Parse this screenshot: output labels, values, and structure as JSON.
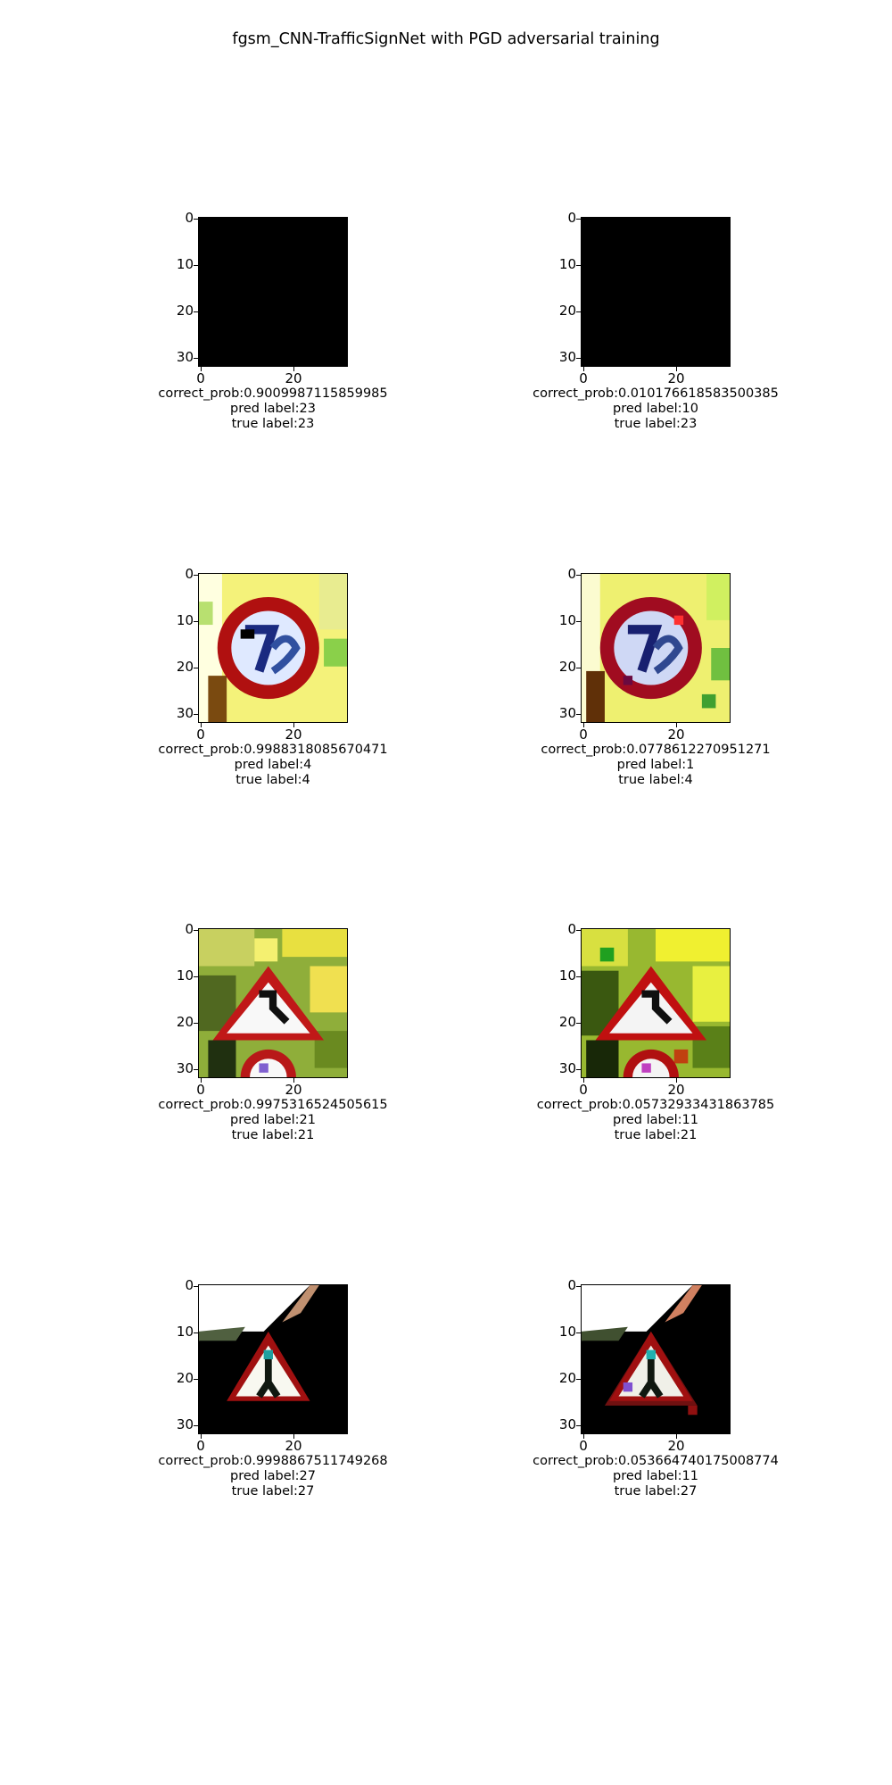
{
  "title": "fgsm_CNN-TrafficSignNet with PGD adversarial training",
  "chart_data": {
    "type": "image-grid",
    "title": "fgsm_CNN-TrafficSignNet with PGD adversarial training",
    "rows": 4,
    "cols": 2,
    "axis_ticks": {
      "x": [
        "0",
        "20"
      ],
      "y": [
        "0",
        "10",
        "20",
        "30"
      ]
    },
    "panels": [
      {
        "kind": "clean",
        "image": "black-square",
        "correct_prob": "correct_prob:0.9009987115859985",
        "pred_label": "pred label:23",
        "true_label": "true label:23"
      },
      {
        "kind": "adversarial",
        "image": "black-square",
        "correct_prob": "correct_prob:0.010176618583500385",
        "pred_label": "pred label:10",
        "true_label": "true label:23"
      },
      {
        "kind": "clean",
        "image": "speed-limit-70-sign",
        "correct_prob": "correct_prob:0.9988318085670471",
        "pred_label": "pred label:4",
        "true_label": "true label:4"
      },
      {
        "kind": "adversarial",
        "image": "speed-limit-70-sign",
        "correct_prob": "correct_prob:0.0778612270951271",
        "pred_label": "pred label:1",
        "true_label": "true label:4"
      },
      {
        "kind": "clean",
        "image": "double-curve-warning-sign",
        "correct_prob": "correct_prob:0.9975316524505615",
        "pred_label": "pred label:21",
        "true_label": "true label:21"
      },
      {
        "kind": "adversarial",
        "image": "double-curve-warning-sign",
        "correct_prob": "correct_prob:0.05732933431863785",
        "pred_label": "pred label:11",
        "true_label": "true label:21"
      },
      {
        "kind": "clean",
        "image": "pedestrian-warning-sign",
        "correct_prob": "correct_prob:0.9998867511749268",
        "pred_label": "pred label:27",
        "true_label": "true label:27"
      },
      {
        "kind": "adversarial",
        "image": "pedestrian-warning-sign",
        "correct_prob": "correct_prob:0.053664740175008774",
        "pred_label": "pred label:11",
        "true_label": "true label:27"
      }
    ]
  }
}
